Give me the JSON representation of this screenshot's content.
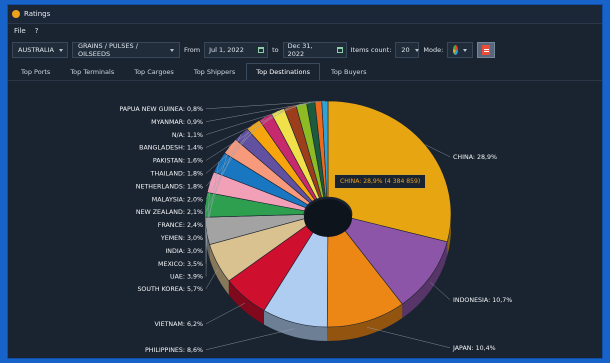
{
  "window": {
    "title": "Ratings"
  },
  "menu": {
    "file": "File",
    "help": "?"
  },
  "toolbar": {
    "country": "AUSTRALIA",
    "commodity": "GRAINS / PULSES / OILSEEDS",
    "from_label": "From",
    "from_date": "Jul 1, 2022",
    "to_label": "to",
    "to_date": "Dec 31, 2022",
    "items_count_label": "Items count:",
    "items_count": "20",
    "mode_label": "Mode:"
  },
  "tabs": [
    "Top Ports",
    "Top Terminals",
    "Top Cargoes",
    "Top Shippers",
    "Top Destinations",
    "Top Buyers"
  ],
  "active_tab": "Top Destinations",
  "tooltip": "CHINA: 28,9% (4 384 859)",
  "chart_data": {
    "type": "pie",
    "style": "3d-donut",
    "slices": [
      {
        "label": "CHINA",
        "text": "CHINA: 28,9%",
        "value": 28.9,
        "color": "#E8A512"
      },
      {
        "label": "INDONESIA",
        "text": "INDONESIA: 10,7%",
        "value": 10.7,
        "color": "#8D55A8"
      },
      {
        "label": "JAPAN",
        "text": "JAPAN: 10,4%",
        "value": 10.4,
        "color": "#EC8716"
      },
      {
        "label": "PHILIPPINES",
        "text": "PHILIPPINES: 8,6%",
        "value": 8.6,
        "color": "#AFCDF0"
      },
      {
        "label": "VIETNAM",
        "text": "VIETNAM: 6,2%",
        "value": 6.2,
        "color": "#CF0F2E"
      },
      {
        "label": "SOUTH KOREA",
        "text": "SOUTH KOREA: 5,7%",
        "value": 5.7,
        "color": "#D9C290"
      },
      {
        "label": "UAE",
        "text": "UAE: 3,9%",
        "value": 3.9,
        "color": "#A3A3A3"
      },
      {
        "label": "MEXICO",
        "text": "MEXICO: 3,5%",
        "value": 3.5,
        "color": "#2D9F4E"
      },
      {
        "label": "INDIA",
        "text": "INDIA: 3,0%",
        "value": 3.0,
        "color": "#F29FB8"
      },
      {
        "label": "YEMEN",
        "text": "YEMEN: 3,0%",
        "value": 3.0,
        "color": "#1976C0"
      },
      {
        "label": "FRANCE",
        "text": "FRANCE: 2,4%",
        "value": 2.4,
        "color": "#F79A7C"
      },
      {
        "label": "NEW ZEALAND",
        "text": "NEW ZEALAND: 2,1%",
        "value": 2.1,
        "color": "#6250A1"
      },
      {
        "label": "MALAYSIA",
        "text": "MALAYSIA: 2,0%",
        "value": 2.0,
        "color": "#F6A50E"
      },
      {
        "label": "NETHERLANDS",
        "text": "NETHERLANDS: 1,8%",
        "value": 1.8,
        "color": "#C72A6C"
      },
      {
        "label": "THAILAND",
        "text": "THAILAND: 1,8%",
        "value": 1.8,
        "color": "#F0E14B"
      },
      {
        "label": "PAKISTAN",
        "text": "PAKISTAN: 1,6%",
        "value": 1.6,
        "color": "#9C3D1C"
      },
      {
        "label": "BANGLADESH",
        "text": "BANGLADESH: 1,4%",
        "value": 1.4,
        "color": "#8DBB24"
      },
      {
        "label": "N/A",
        "text": "N/A: 1,1%",
        "value": 1.1,
        "color": "#1D5B3E"
      },
      {
        "label": "MYANMAR",
        "text": "MYANMAR: 0,9%",
        "value": 0.9,
        "color": "#EE6A1E"
      },
      {
        "label": "PAPUA NEW GUINEA",
        "text": "PAPUA NEW GUINEA: 0,8%",
        "value": 0.8,
        "color": "#2FA3D8"
      }
    ]
  }
}
